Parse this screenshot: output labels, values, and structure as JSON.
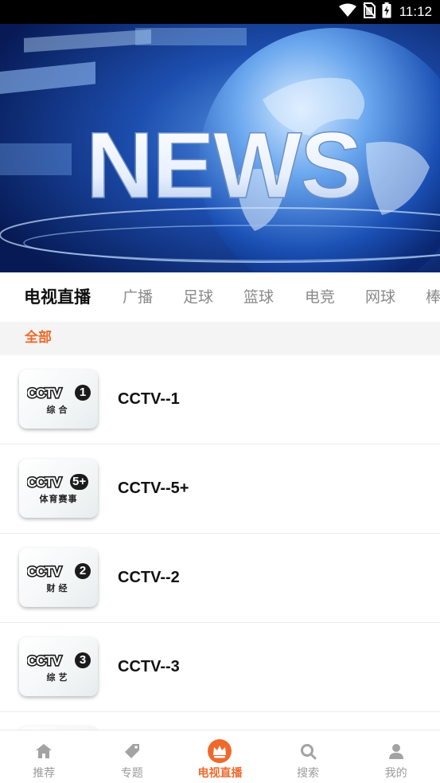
{
  "status_bar": {
    "time": "11:12",
    "icons": [
      "wifi-icon",
      "no-sim-icon",
      "battery-charging-icon"
    ]
  },
  "banner": {
    "headline": "NEWS"
  },
  "tabs": [
    {
      "label": "电视直播",
      "active": true
    },
    {
      "label": "广播",
      "active": false
    },
    {
      "label": "足球",
      "active": false
    },
    {
      "label": "篮球",
      "active": false
    },
    {
      "label": "电竞",
      "active": false
    },
    {
      "label": "网球",
      "active": false
    },
    {
      "label": "棒",
      "active": false
    }
  ],
  "category": {
    "label": "全部",
    "color": "#ee6a2c"
  },
  "channels": [
    {
      "name": "CCTV--1",
      "logo": {
        "word": "CCTV",
        "badge": "1",
        "sub": "综合"
      }
    },
    {
      "name": "CCTV--5+",
      "logo": {
        "word": "CCTV",
        "badge": "5+",
        "sub": "体育赛事"
      }
    },
    {
      "name": "CCTV--2",
      "logo": {
        "word": "CCTV",
        "badge": "2",
        "sub": "财经"
      }
    },
    {
      "name": "CCTV--3",
      "logo": {
        "word": "CCTV",
        "badge": "3",
        "sub": "综艺"
      }
    }
  ],
  "bottom_nav": [
    {
      "label": "推荐",
      "icon": "home-icon",
      "active": false
    },
    {
      "label": "专题",
      "icon": "tag-icon",
      "active": false
    },
    {
      "label": "电视直播",
      "icon": "crown-icon",
      "active": true
    },
    {
      "label": "搜索",
      "icon": "search-icon",
      "active": false
    },
    {
      "label": "我的",
      "icon": "user-icon",
      "active": false
    }
  ],
  "colors": {
    "accent": "#ee6a2c",
    "inactive": "#9b9b9b",
    "status_bar": "#000000"
  }
}
